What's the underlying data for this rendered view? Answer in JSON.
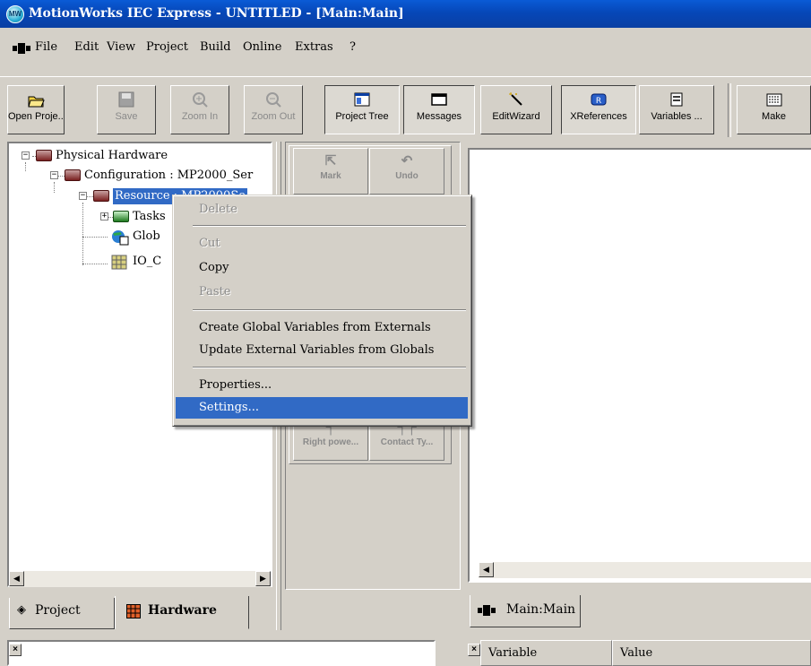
{
  "window": {
    "title": "MotionWorks IEC Express - UNTITLED - [Main:Main]"
  },
  "menu": [
    "File",
    "Edit",
    "View",
    "Project",
    "Build",
    "Online",
    "Extras",
    "?"
  ],
  "toolbar": [
    {
      "label": "Open Proje...",
      "icon": "open-folder-icon",
      "state": "enabled"
    },
    {
      "label": "Save",
      "icon": "save-icon",
      "state": "disabled"
    },
    {
      "label": "Zoom In",
      "icon": "zoom-in-icon",
      "state": "disabled"
    },
    {
      "label": "Zoom Out",
      "icon": "zoom-out-icon",
      "state": "disabled"
    },
    {
      "label": "Project Tree",
      "icon": "project-tree-icon",
      "state": "pressed"
    },
    {
      "label": "Messages",
      "icon": "messages-icon",
      "state": "pressed"
    },
    {
      "label": "EditWizard",
      "icon": "wand-icon",
      "state": "enabled"
    },
    {
      "label": "XReferences",
      "icon": "xreferences-icon",
      "state": "pressed"
    },
    {
      "label": "Variables ...",
      "icon": "variables-icon",
      "state": "enabled"
    },
    {
      "label": "Make",
      "icon": "make-icon",
      "state": "enabled"
    }
  ],
  "tree": {
    "physical_hardware": "Physical Hardware",
    "configuration": "Configuration : MP2000_Ser",
    "resource": "Resource : MP2000Se",
    "tasks": "Tasks",
    "globals": "Glob",
    "io": "IO_C"
  },
  "editor_tools": {
    "mark": "Mark",
    "undo": "Undo",
    "right_power": "Right powe...",
    "contact_type": "Contact Ty..."
  },
  "left_tabs": {
    "project": "Project",
    "hardware": "Hardware"
  },
  "editor_tab": "Main:Main",
  "context_menu": {
    "delete": "Delete",
    "cut": "Cut",
    "copy": "Copy",
    "paste": "Paste",
    "create_globals": "Create Global Variables from Externals",
    "update_externals": "Update External Variables from Globals",
    "properties": "Properties...",
    "settings": "Settings..."
  },
  "variables_grid": {
    "col_variable": "Variable",
    "col_value": "Value"
  },
  "colors": {
    "title_bar": "#0a4fc4",
    "menu_highlight": "#316ac5",
    "face": "#d4d0c8"
  }
}
